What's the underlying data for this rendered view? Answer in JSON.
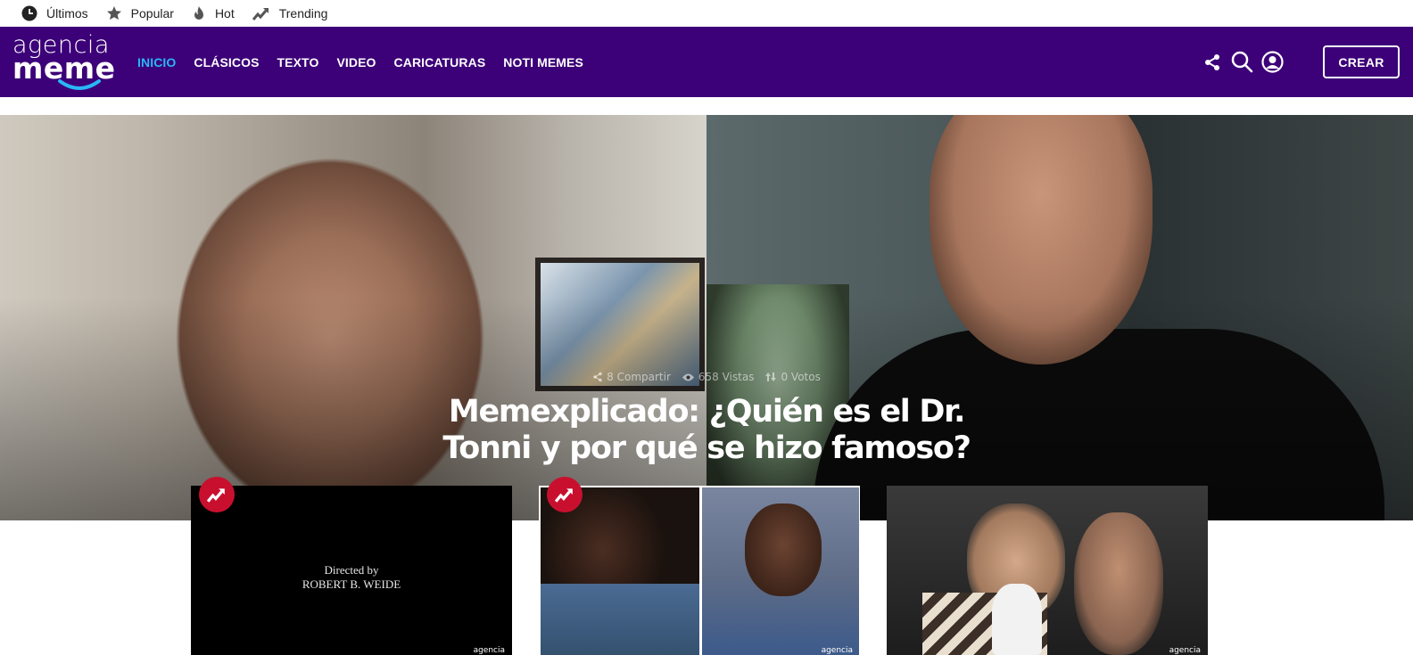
{
  "topbar": {
    "items": [
      {
        "label": "Últimos",
        "icon": "clock-icon"
      },
      {
        "label": "Popular",
        "icon": "star-icon"
      },
      {
        "label": "Hot",
        "icon": "flame-icon"
      },
      {
        "label": "Trending",
        "icon": "trending-icon"
      }
    ]
  },
  "header": {
    "logo_line1": "agencia",
    "logo_line2": "meme",
    "nav": [
      {
        "label": "INICIO",
        "active": true
      },
      {
        "label": "CLÁSICOS",
        "active": false
      },
      {
        "label": "TEXTO",
        "active": false
      },
      {
        "label": "VIDEO",
        "active": false
      },
      {
        "label": "CARICATURAS",
        "active": false
      },
      {
        "label": "NOTI MEMES",
        "active": false
      }
    ],
    "create_label": "CREAR",
    "icons": [
      "share-icon",
      "search-icon",
      "user-account-icon"
    ]
  },
  "hero": {
    "stats": {
      "shares": "8 Compartir",
      "views": "658 Vistas",
      "votes": "0 Votos"
    },
    "title": "Memexplicado: ¿Quién es el Dr. Tonni y por qué se hizo famoso?"
  },
  "cards": [
    {
      "caption_line1": "Directed by",
      "caption_line2": "ROBERT B. WEIDE",
      "watermark": "agencia",
      "trending": true
    },
    {
      "watermark": "agencia",
      "trending": true
    },
    {
      "watermark": "agencia",
      "trending": false
    }
  ],
  "colors": {
    "header_bg": "#3c0078",
    "nav_active": "#29b6f6",
    "trend_badge": "#c8102e"
  }
}
